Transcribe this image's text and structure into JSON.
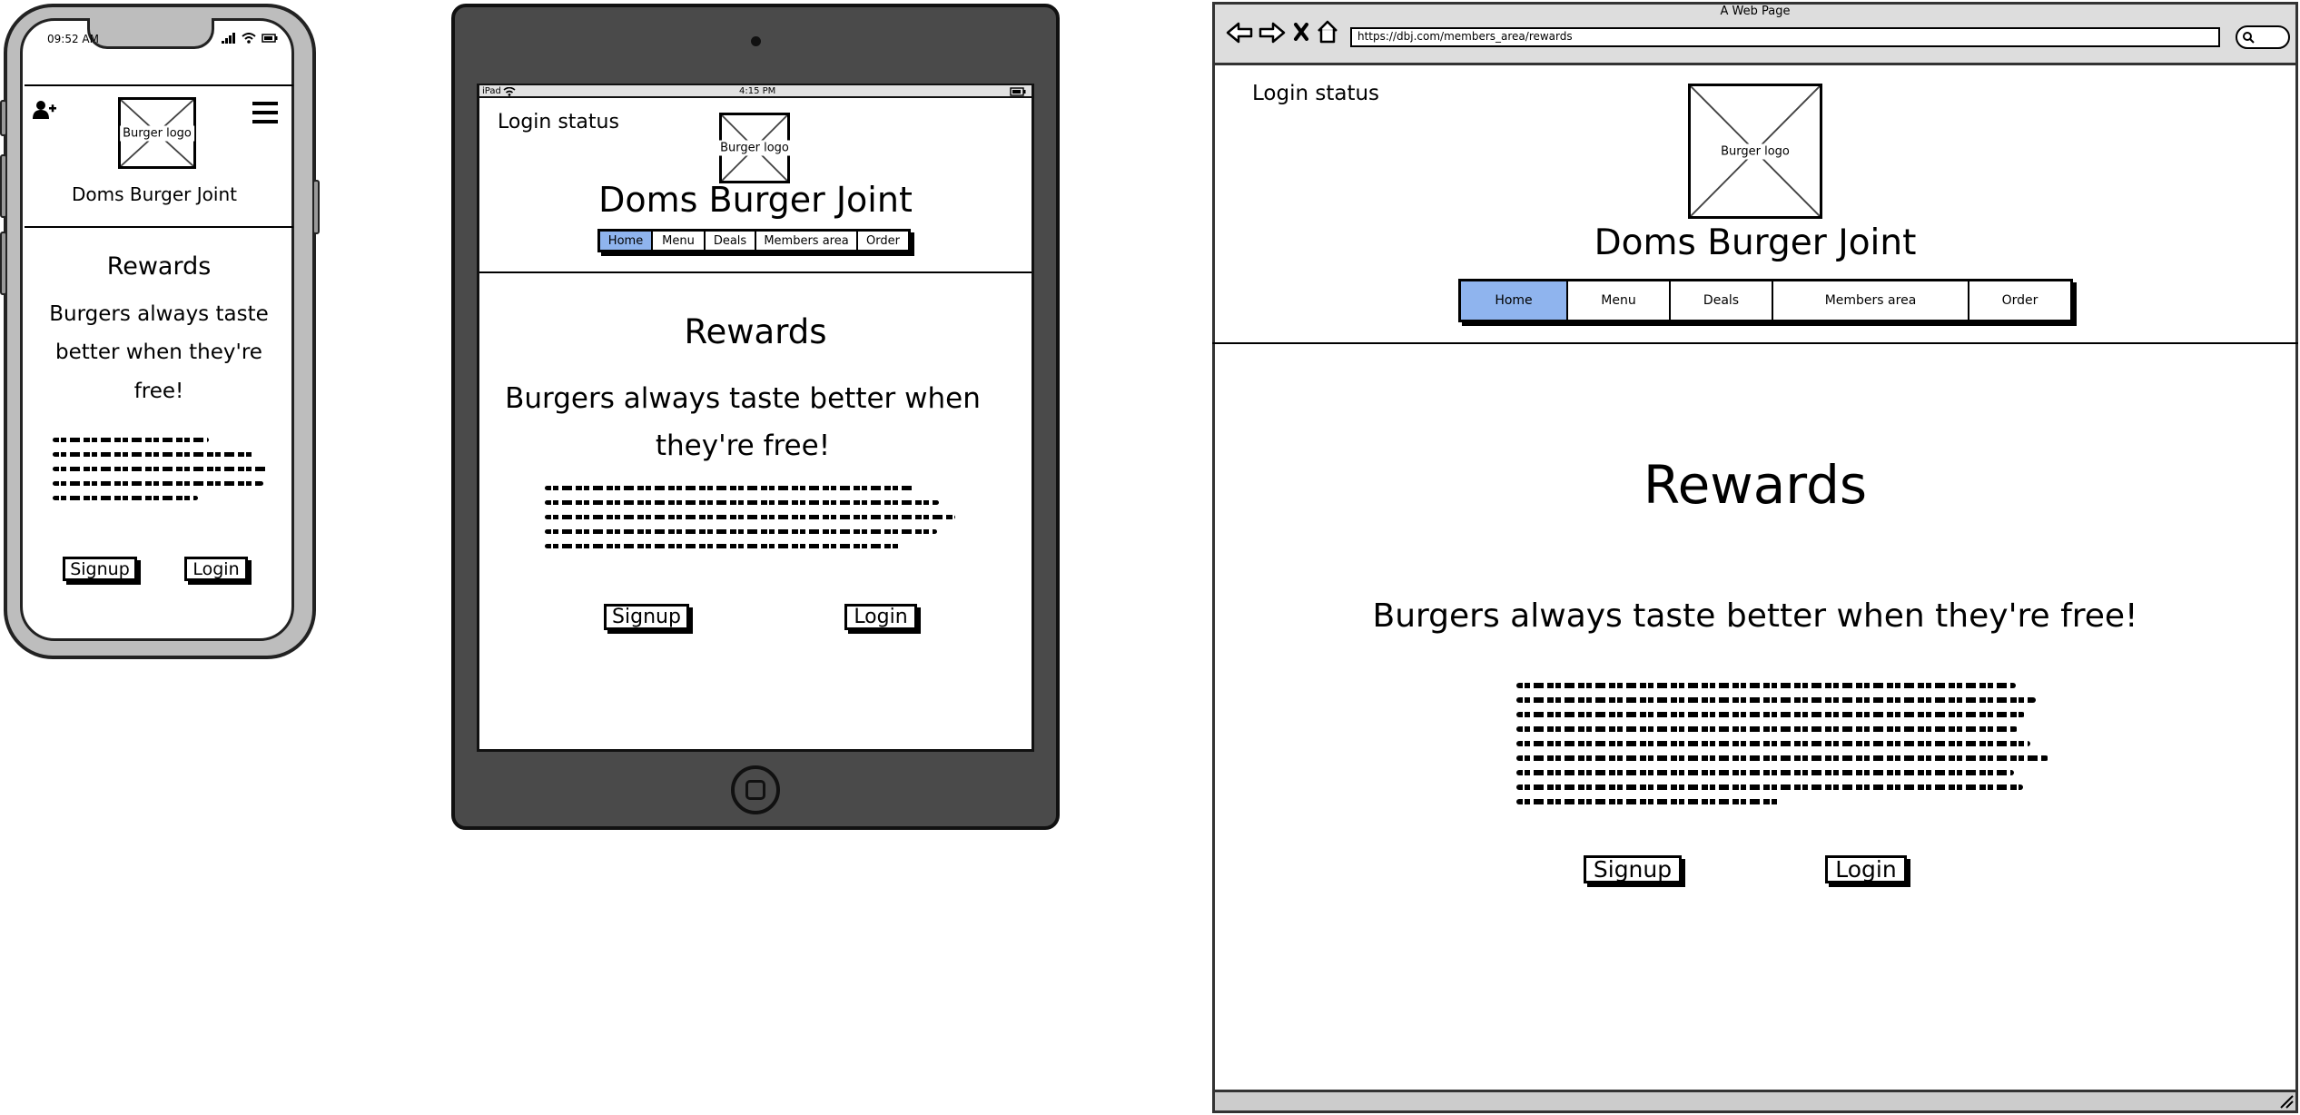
{
  "phone": {
    "status_time": "09:52 AM",
    "logo_label": "Burger logo",
    "site_name": "Doms Burger Joint",
    "heading": "Rewards",
    "tagline_lines": [
      "Burgers always taste",
      "better when they're",
      "free!"
    ],
    "signup_label": "Signup",
    "login_label": "Login"
  },
  "tablet": {
    "status_device": "iPad",
    "status_time": "4:15 PM",
    "login_status": "Login status",
    "logo_label": "Burger logo",
    "site_name": "Doms Burger Joint",
    "nav": [
      "Home",
      "Menu",
      "Deals",
      "Members area",
      "Order"
    ],
    "heading": "Rewards",
    "tagline_lines": [
      "Burgers always taste better when",
      "they're free!"
    ],
    "signup_label": "Signup",
    "login_label": "Login"
  },
  "browser": {
    "window_title": "A Web Page",
    "url": "https://dbj.com/members_area/rewards",
    "login_status": "Login status",
    "logo_label": "Burger logo",
    "site_name": "Doms Burger Joint",
    "nav": [
      "Home",
      "Menu",
      "Deals",
      "Members area",
      "Order"
    ],
    "heading": "Rewards",
    "tagline": "Burgers always taste better when they're free!",
    "signup_label": "Signup",
    "login_label": "Login"
  },
  "colors": {
    "active_tab": "#8fb4ee",
    "device_bezel_phone": "#bdbdbd",
    "device_bezel_tablet": "#4a4a4a",
    "browser_chrome": "#dddddd"
  }
}
